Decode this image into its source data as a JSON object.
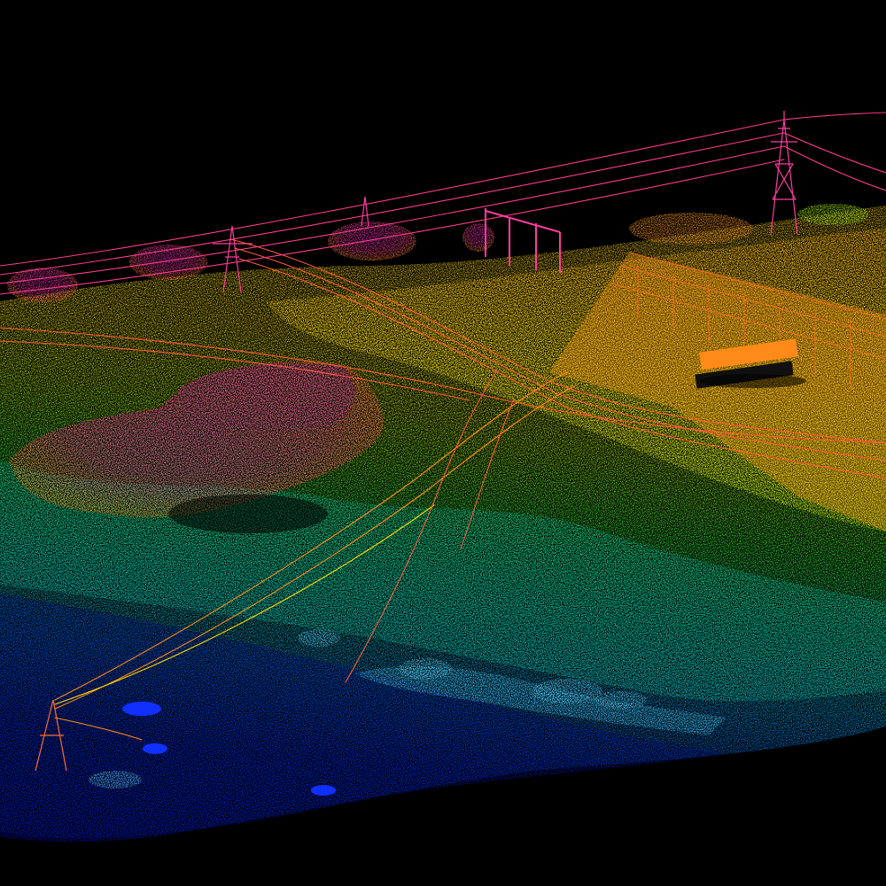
{
  "scene": {
    "type": "lidar-point-cloud",
    "colormap": "elevation",
    "background_color": "#000000"
  },
  "colors": {
    "low": "#0010c8",
    "low_mid": "#00a0ff",
    "mid": "#00e8a0",
    "mid_high": "#b8ff00",
    "high": "#ffee00",
    "higher": "#ff8a1a",
    "top": "#ff2ad0",
    "wire": "#ff5a3c",
    "wire_high": "#ff3c8c"
  },
  "icons": {
    "transmission_tower": "transmission-tower-icon",
    "tree_canopy": "tree-canopy-icon"
  }
}
